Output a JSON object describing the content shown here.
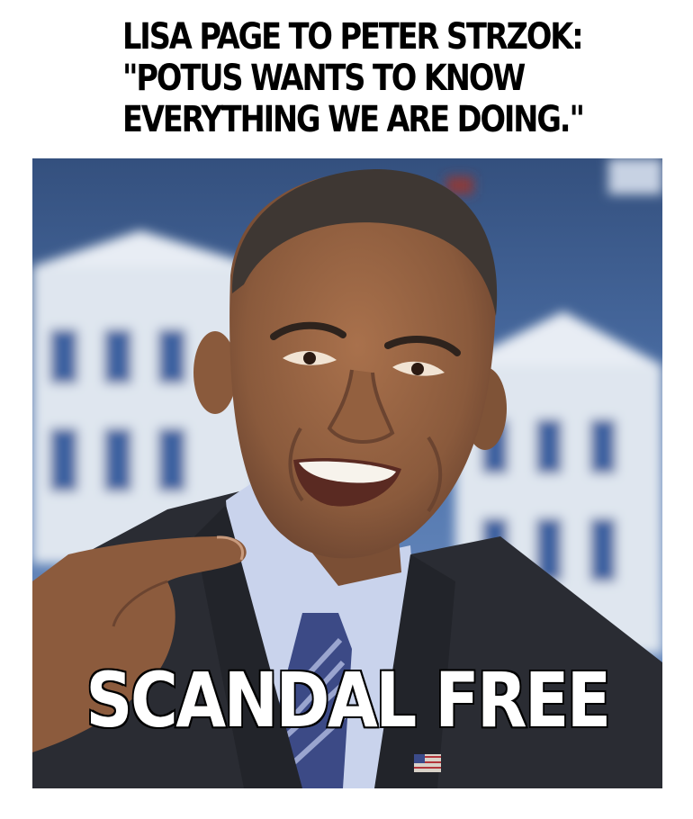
{
  "meme": {
    "top_caption_lines": [
      "LISA PAGE TO PETER STRZOK:",
      "\"POTUS WANTS TO KNOW",
      "EVERYTHING WE ARE DOING.\""
    ],
    "bottom_caption": "SCANDAL FREE"
  },
  "colors": {
    "background": "#ffffff",
    "caption_top": "#000000",
    "caption_bottom_fill": "#ffffff",
    "caption_bottom_stroke": "#000000",
    "photo_sky": "#4a6fa8",
    "building": "#dfe6ef",
    "suit": "#2a2c33",
    "shirt": "#c9d3ec",
    "skin": "#8a5a3c"
  }
}
